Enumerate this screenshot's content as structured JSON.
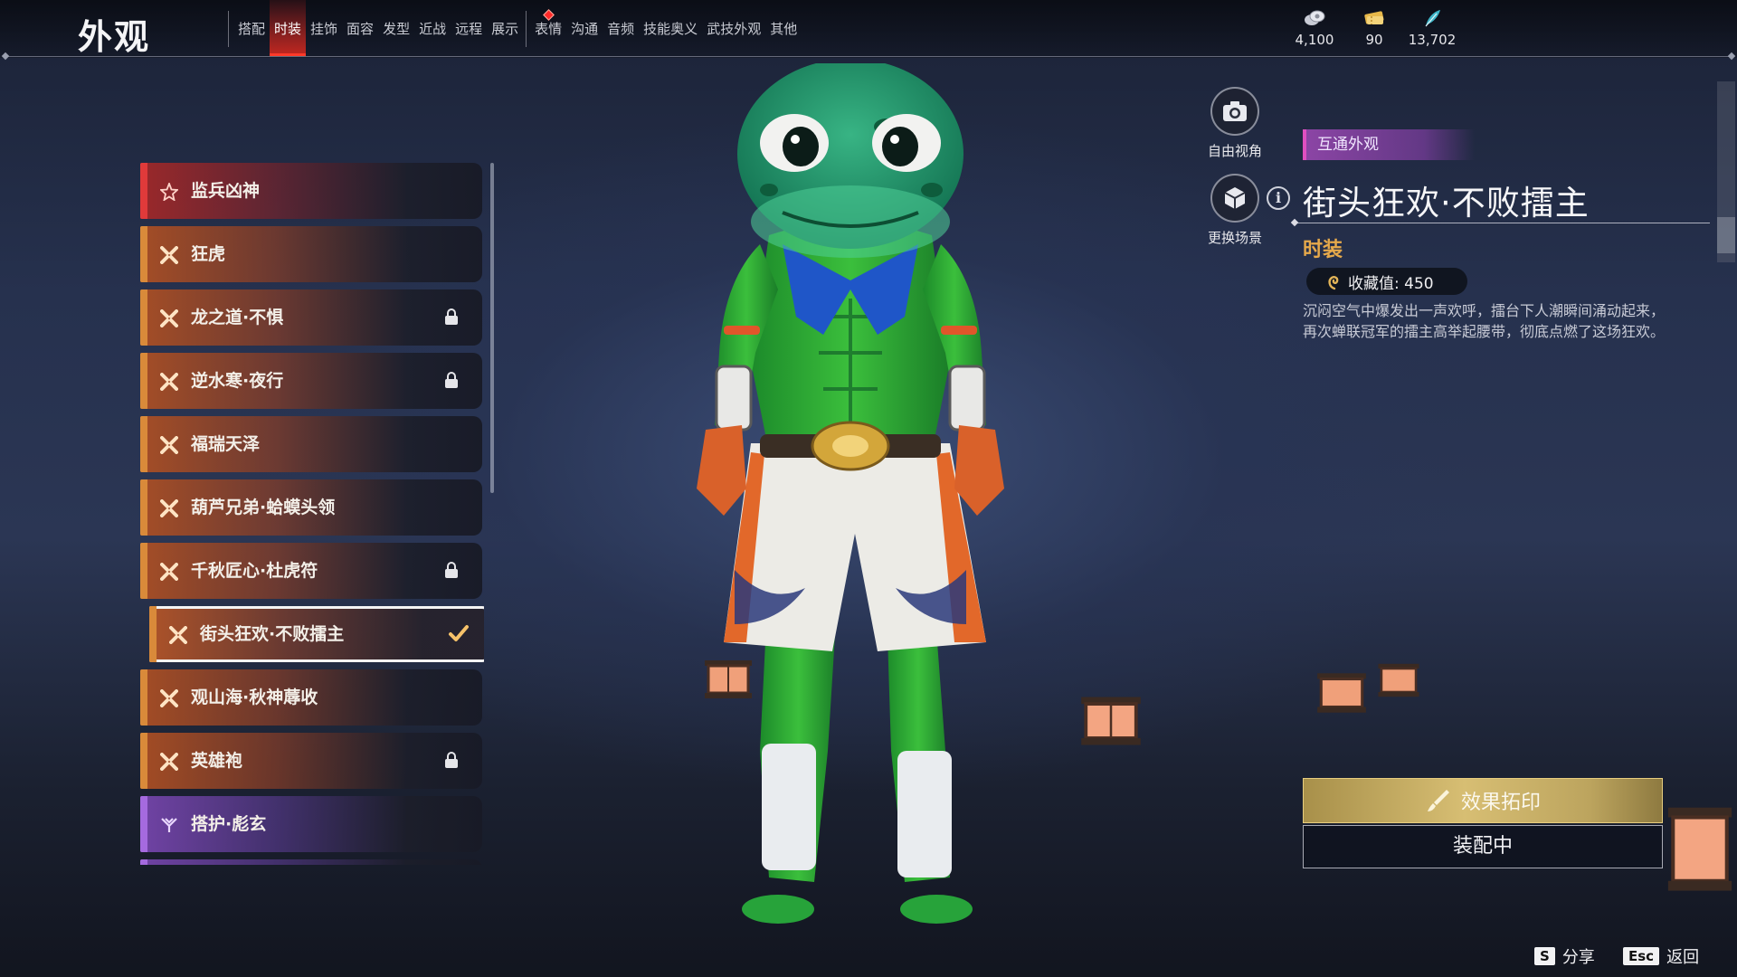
{
  "header": {
    "title": "外观",
    "tabs_group1": [
      {
        "label": "搭配",
        "active": false
      },
      {
        "label": "时装",
        "active": true
      },
      {
        "label": "挂饰",
        "active": false
      },
      {
        "label": "面容",
        "active": false
      },
      {
        "label": "发型",
        "active": false
      },
      {
        "label": "近战",
        "active": false
      },
      {
        "label": "远程",
        "active": false
      },
      {
        "label": "展示",
        "active": false
      }
    ],
    "tabs_group2": [
      {
        "label": "表情",
        "notify": true
      },
      {
        "label": "沟通",
        "notify": false
      },
      {
        "label": "音频",
        "notify": false
      },
      {
        "label": "技能奥义",
        "notify": false
      },
      {
        "label": "武技外观",
        "notify": false
      },
      {
        "label": "其他",
        "notify": false
      }
    ],
    "currencies": [
      {
        "icon": "coin-stack-icon",
        "value": "4,100"
      },
      {
        "icon": "ticket-icon",
        "value": "90"
      },
      {
        "icon": "feather-icon",
        "value": "13,702"
      }
    ]
  },
  "outfit_list": [
    {
      "label": "监兵凶神",
      "rarity": "red",
      "locked": false,
      "selected": false
    },
    {
      "label": "狂虎",
      "rarity": "orange",
      "locked": false,
      "selected": false
    },
    {
      "label": "龙之道·不惧",
      "rarity": "orange",
      "locked": true,
      "selected": false
    },
    {
      "label": "逆水寒·夜行",
      "rarity": "orange",
      "locked": true,
      "selected": false
    },
    {
      "label": "福瑞天泽",
      "rarity": "orange",
      "locked": false,
      "selected": false
    },
    {
      "label": "葫芦兄弟·蛤蟆头领",
      "rarity": "orange",
      "locked": false,
      "selected": false
    },
    {
      "label": "千秋匠心·杜虎符",
      "rarity": "orange",
      "locked": true,
      "selected": false
    },
    {
      "label": "街头狂欢·不败擂主",
      "rarity": "orange",
      "locked": false,
      "selected": true
    },
    {
      "label": "观山海·秋神蓐收",
      "rarity": "orange",
      "locked": false,
      "selected": false
    },
    {
      "label": "英雄袍",
      "rarity": "orange",
      "locked": true,
      "selected": false
    },
    {
      "label": "搭护·彪玄",
      "rarity": "purple",
      "locked": false,
      "selected": false
    }
  ],
  "view_controls": {
    "free_view": "自由视角",
    "change_scene": "更换场景"
  },
  "detail": {
    "tag": "互通外观",
    "name": "街头狂欢·不败擂主",
    "category": "时装",
    "collect_value": "收藏值: 450",
    "description": "沉闷空气中爆发出一声欢呼，擂台下人潮瞬间涌动起来，再次蝉联冠军的擂主高举起腰带，彻底点燃了这场狂欢。"
  },
  "buttons": {
    "effect_imprint": "效果拓印",
    "equipping": "装配中"
  },
  "hints": {
    "share_key": "S",
    "share_label": "分享",
    "back_key": "Esc",
    "back_label": "返回"
  },
  "colors": {
    "active_tab": "#d8281e",
    "rarity_orange": "#d98a3a",
    "rarity_red": "#e03a3a",
    "rarity_purple": "#a56adf",
    "category_gold": "#e6a94b",
    "tag_purple": "#9146aa"
  }
}
